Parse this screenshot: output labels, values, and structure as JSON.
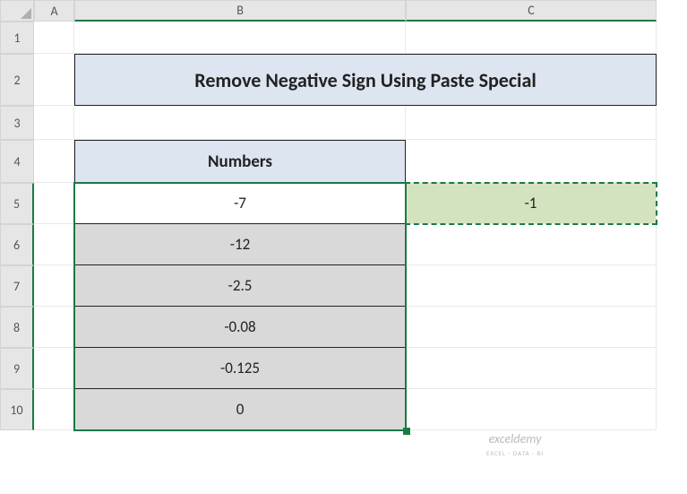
{
  "columns": {
    "A": "A",
    "B": "B",
    "C": "C"
  },
  "rows": [
    "1",
    "2",
    "3",
    "4",
    "5",
    "6",
    "7",
    "8",
    "9",
    "10"
  ],
  "title": "Remove Negative Sign Using Paste Special",
  "table": {
    "header": "Numbers",
    "values": [
      "-7",
      "-12",
      "-2.5",
      "-0.08",
      "-0.125",
      "0"
    ]
  },
  "helper_value": "-1",
  "watermark": {
    "main": "exceldemy",
    "sub": "EXCEL · DATA · BI"
  },
  "chart_data": {
    "type": "table",
    "title": "Remove Negative Sign Using Paste Special",
    "columns": [
      "Numbers"
    ],
    "rows": [
      [
        -7
      ],
      [
        -12
      ],
      [
        -2.5
      ],
      [
        -0.08
      ],
      [
        -0.125
      ],
      [
        0
      ]
    ],
    "helper_cell": {
      "col": "C",
      "row": 5,
      "value": -1
    }
  }
}
